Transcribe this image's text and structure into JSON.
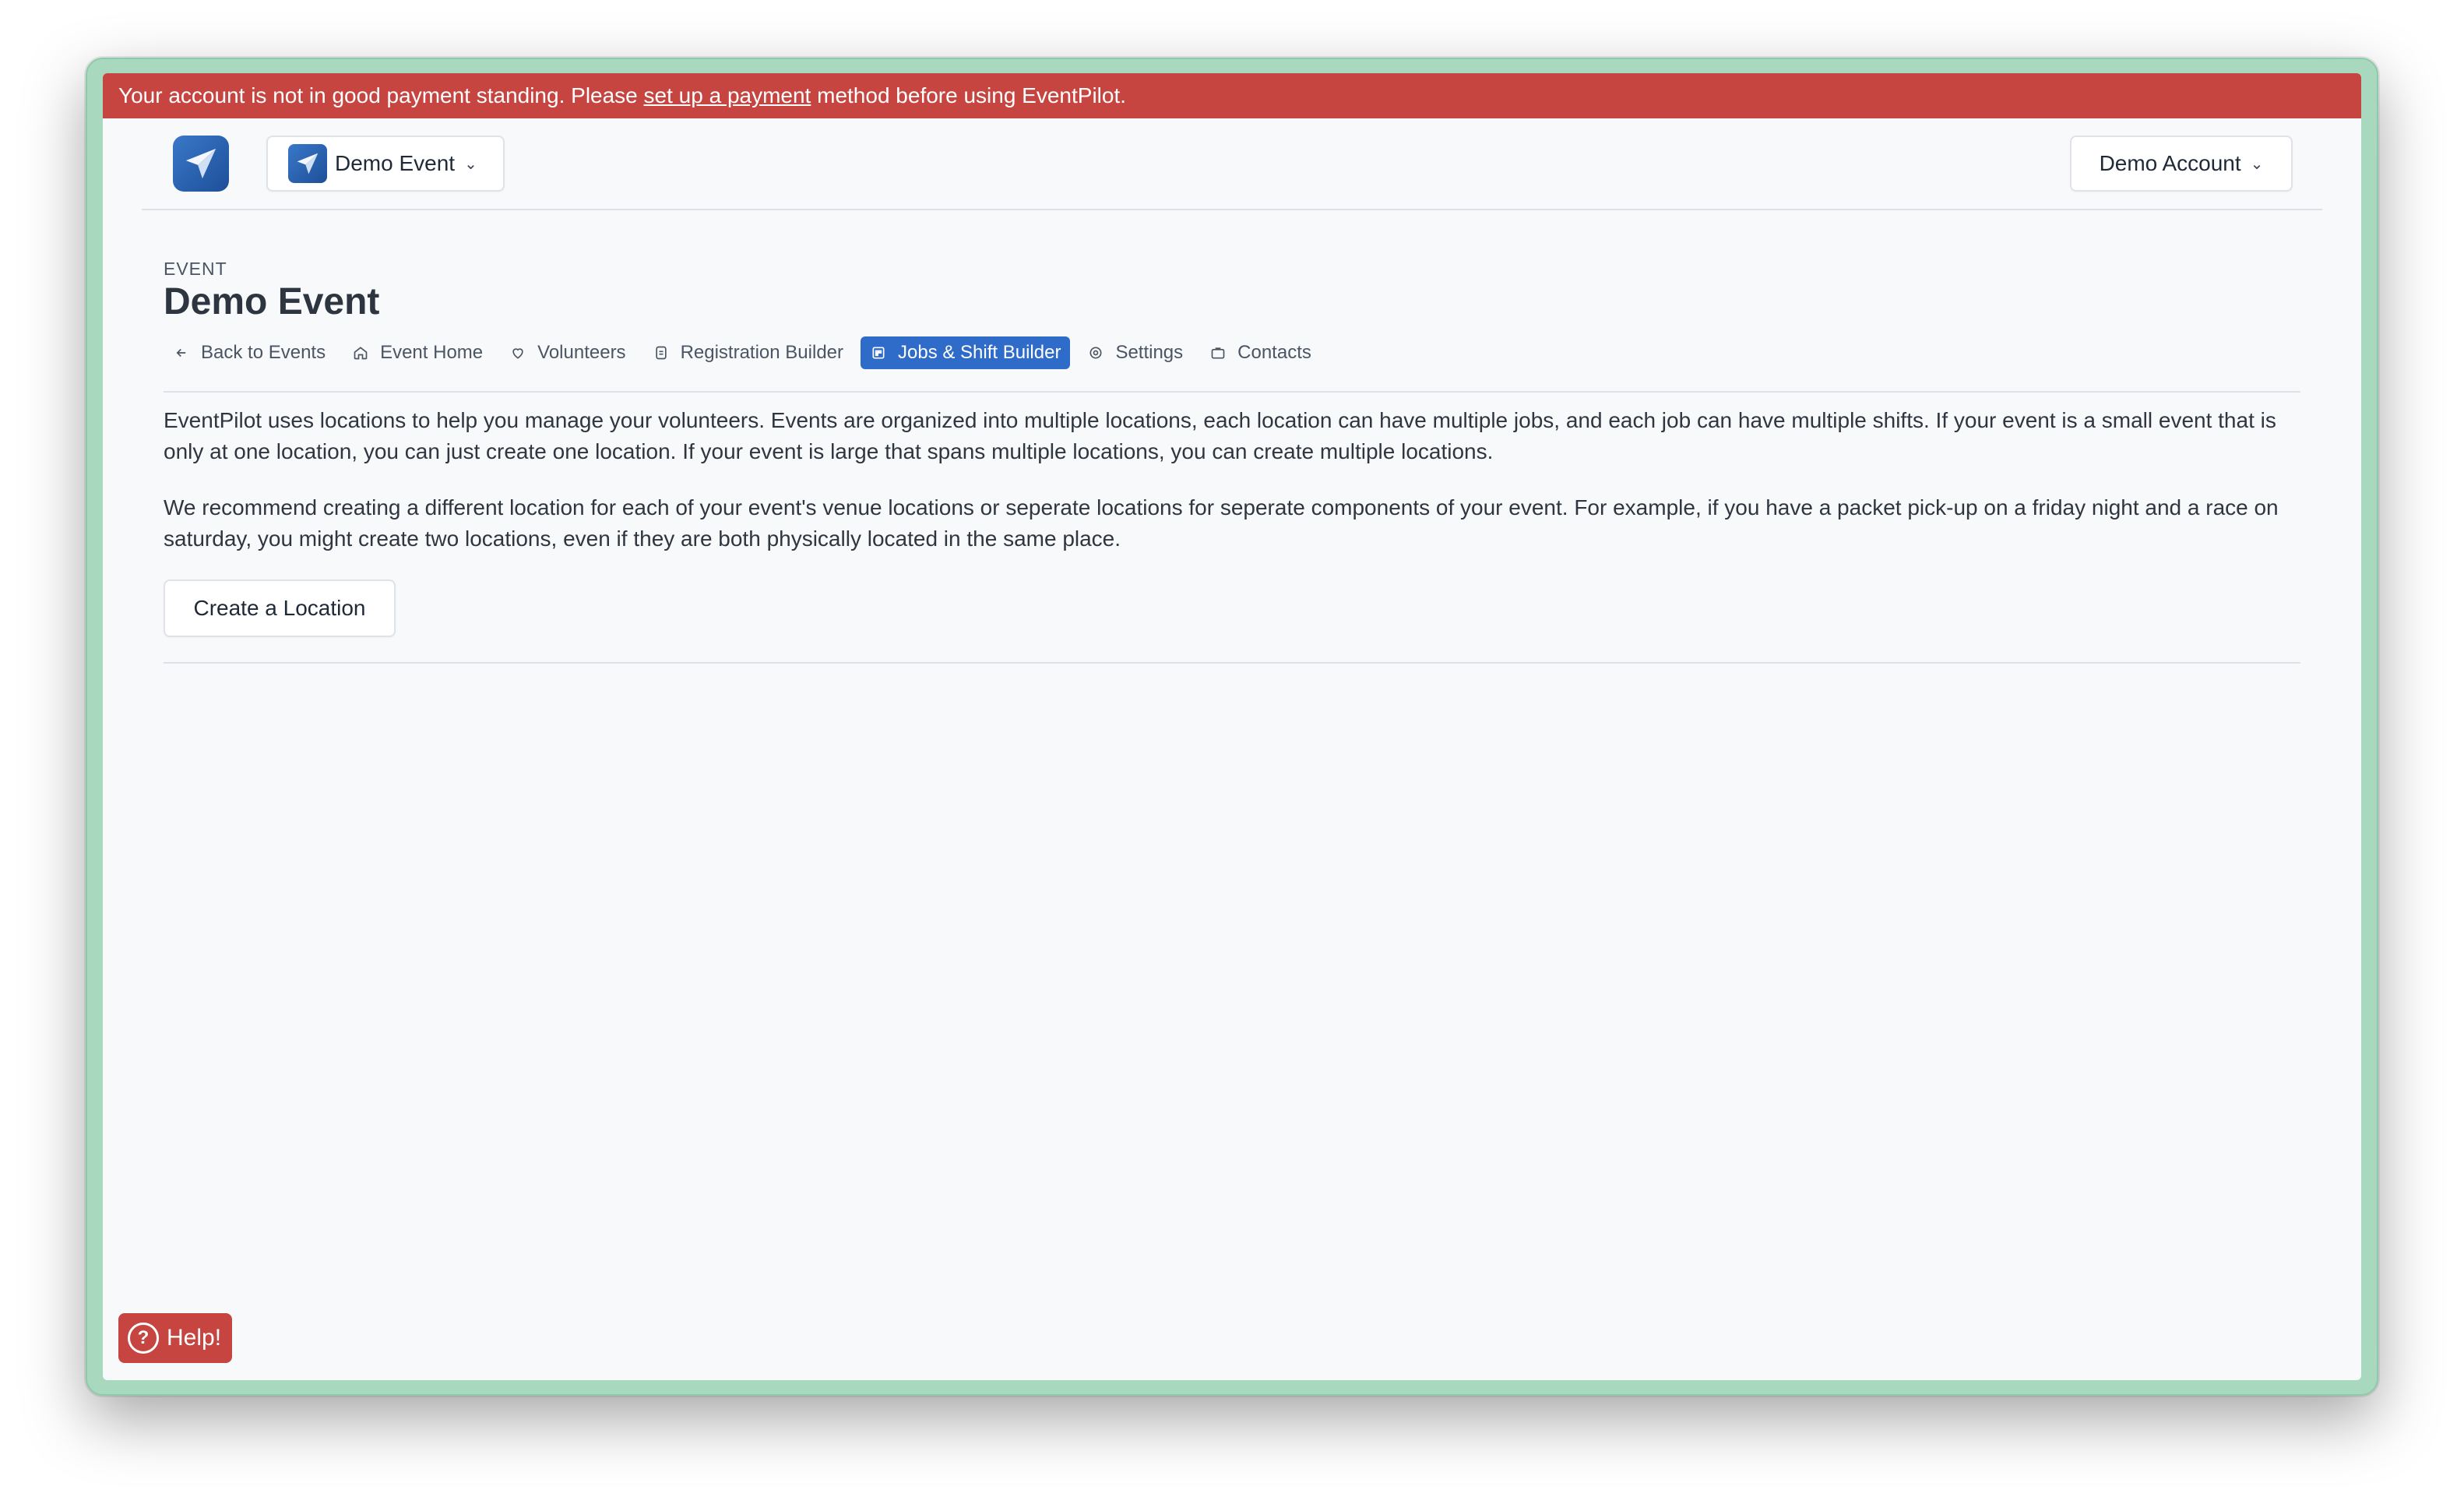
{
  "banner": {
    "text_before": "Your account is not in good payment standing. Please ",
    "link_text": "set up a payment",
    "text_after": " method before using EventPilot."
  },
  "header": {
    "logo_icon": "paper-plane-icon",
    "event_switcher_label": "Demo Event",
    "account_switcher_label": "Demo Account",
    "chevron": "⌄"
  },
  "page": {
    "eyebrow": "EVENT",
    "title": "Demo Event"
  },
  "tabs": [
    {
      "label": "Back to Events",
      "icon": "arrow-left-icon",
      "active": false
    },
    {
      "label": "Event Home",
      "icon": "home-icon",
      "active": false
    },
    {
      "label": "Volunteers",
      "icon": "heart-icon",
      "active": false
    },
    {
      "label": "Registration Builder",
      "icon": "form-icon",
      "active": false
    },
    {
      "label": "Jobs & Shift Builder",
      "icon": "calendar-grid-icon",
      "active": true
    },
    {
      "label": "Settings",
      "icon": "gear-icon",
      "active": false
    },
    {
      "label": "Contacts",
      "icon": "briefcase-icon",
      "active": false
    }
  ],
  "content": {
    "paragraph_1": "EventPilot uses locations to help you manage your volunteers. Events are organized into multiple locations, each location can have multiple jobs, and each job can have multiple shifts. If your event is a small event that is only at one location, you can just create one location. If your event is large that spans multiple locations, you can create multiple locations.",
    "paragraph_2": "We recommend creating a different location for each of your event's venue locations or seperate locations for seperate components of your event. For example, if you have a packet pick-up on a friday night and a race on saturday, you might create two locations, even if they are both physically located in the same place.",
    "create_button": "Create a Location"
  },
  "help": {
    "label": "Help!",
    "icon_glyph": "?"
  },
  "colors": {
    "banner": "#c64541",
    "active_tab": "#2f6bc8",
    "frame": "#a8d9be",
    "help_button": "#c64541"
  }
}
